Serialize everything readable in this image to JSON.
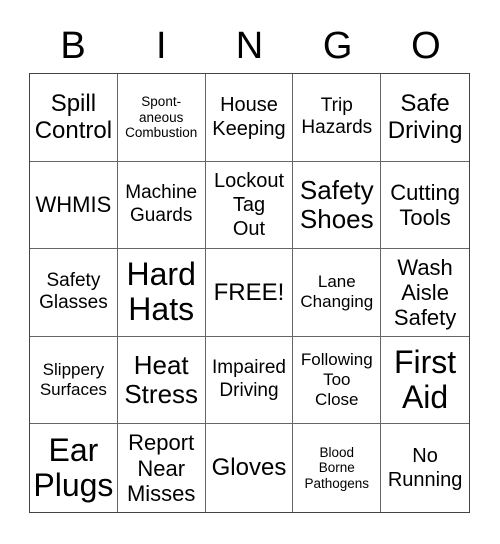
{
  "header": {
    "letters": [
      "B",
      "I",
      "N",
      "G",
      "O"
    ]
  },
  "card": {
    "cells": [
      "Spill\nControl",
      "Spont-\naneous\nCombustion",
      "House\nKeeping",
      "Trip\nHazards",
      "Safe\nDriving",
      "WHMIS",
      "Machine\nGuards",
      "Lockout\nTag\nOut",
      "Safety\nShoes",
      "Cutting\nTools",
      "Safety\nGlasses",
      "Hard\nHats",
      "FREE!",
      "Lane\nChanging",
      "Wash\nAisle\nSafety",
      "Slippery\nSurfaces",
      "Heat\nStress",
      "Impaired\nDriving",
      "Following\nToo\nClose",
      "First\nAid",
      "Ear\nPlugs",
      "Report\nNear\nMisses",
      "Gloves",
      "Blood\nBorne\nPathogens",
      "No\nRunning"
    ]
  }
}
